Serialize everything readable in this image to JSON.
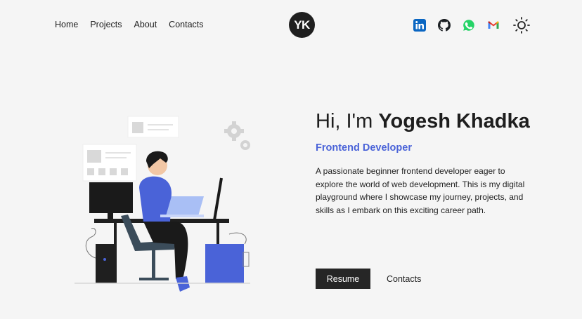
{
  "nav": {
    "links": [
      "Home",
      "Projects",
      "About",
      "Contacts"
    ],
    "logo": "YK"
  },
  "socials": {
    "icons": [
      "linkedin-icon",
      "github-icon",
      "whatsapp-icon",
      "gmail-icon",
      "sun-icon"
    ],
    "colors": {
      "linkedin": "#0a66c2",
      "whatsapp": "#25d366",
      "github": "#1b1f23"
    }
  },
  "hero": {
    "greeting": "Hi, I'm",
    "name": "Yogesh Khadka",
    "role": "Frontend Developer",
    "description": "A passionate beginner frontend developer eager to explore the world of web development. This is my digital playground where I showcase my journey, projects, and skills as I embark on this exciting career path.",
    "resume_label": "Resume",
    "contacts_label": "Contacts"
  },
  "theme": {
    "accent": "#4a63d8",
    "button_bg": "#262626",
    "page_bg": "#f5f5f5"
  }
}
